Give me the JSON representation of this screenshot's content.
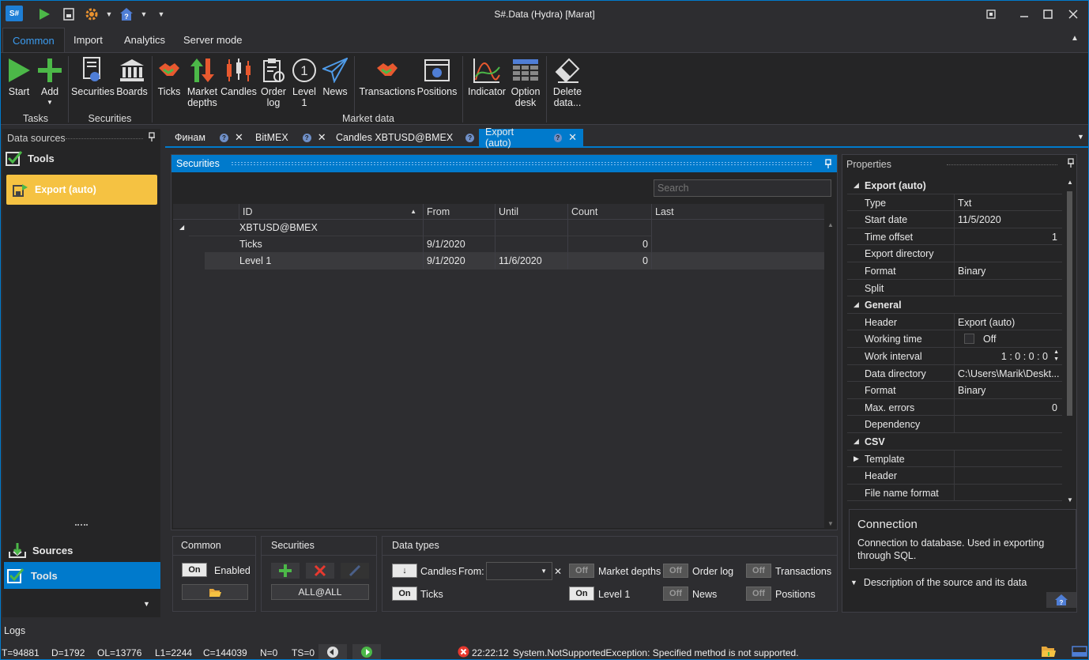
{
  "window": {
    "title": "S#.Data (Hydra) [Marat]",
    "logo": "S#"
  },
  "ribbon": {
    "tabs": [
      "Common",
      "Import",
      "Analytics",
      "Server mode"
    ],
    "buttons": {
      "start": "Start",
      "add": "Add",
      "securities": "Securities",
      "boards": "Boards",
      "ticks": "Ticks",
      "market_depths": "Market depths",
      "candles": "Candles",
      "order_log": "Order log",
      "level1": "Level 1",
      "news": "News",
      "transactions": "Transactions",
      "positions": "Positions",
      "indicator": "Indicator",
      "option_desk": "Option desk",
      "delete_data": "Delete data..."
    },
    "groups": {
      "tasks": "Tasks",
      "securities": "Securities",
      "market_data": "Market data"
    }
  },
  "left_panel": {
    "header": "Data sources",
    "tools_label": "Tools",
    "selected_item": "Export (auto)",
    "nav": {
      "sources": "Sources",
      "tools": "Tools"
    }
  },
  "doc_tabs": [
    "Финам",
    "BitMEX",
    "Candles XBTUSD@BMEX",
    "Export (auto)"
  ],
  "securities": {
    "header": "Securities",
    "search_placeholder": "Search",
    "columns": [
      "ID",
      "From",
      "Until",
      "Count",
      "Last"
    ],
    "group": "XBTUSD@BMEX",
    "rows": [
      {
        "id": "Ticks",
        "from": "9/1/2020",
        "until": "",
        "count": "0",
        "last": ""
      },
      {
        "id": "Level 1",
        "from": "9/1/2020",
        "until": "11/6/2020",
        "count": "0",
        "last": ""
      }
    ]
  },
  "common_box": {
    "title": "Common",
    "toggle": "On",
    "enabled_label": "Enabled"
  },
  "securities_box": {
    "title": "Securities",
    "all": "ALL@ALL"
  },
  "datatypes_box": {
    "title": "Data types",
    "candles": {
      "toggle": "↓",
      "label": "Candles",
      "from_label": "From:"
    },
    "ticks": {
      "toggle": "On",
      "label": "Ticks"
    },
    "market_depths": {
      "toggle": "Off",
      "label": "Market depths"
    },
    "level1": {
      "toggle": "On",
      "label": "Level 1"
    },
    "order_log": {
      "toggle": "Off",
      "label": "Order log"
    },
    "news": {
      "toggle": "Off",
      "label": "News"
    },
    "transactions": {
      "toggle": "Off",
      "label": "Transactions"
    },
    "positions": {
      "toggle": "Off",
      "label": "Positions"
    }
  },
  "properties": {
    "header": "Properties",
    "rows": [
      {
        "cat": true,
        "k": "Export (auto)",
        "v": ""
      },
      {
        "k": "Type",
        "v": "Txt"
      },
      {
        "k": "Start date",
        "v": "11/5/2020"
      },
      {
        "k": "Time offset",
        "vr": "1"
      },
      {
        "k": "Export directory",
        "v": ""
      },
      {
        "k": "Format",
        "v": "Binary"
      },
      {
        "k": "Split",
        "v": ""
      },
      {
        "cat": true,
        "k": "General",
        "v": ""
      },
      {
        "k": "Header",
        "v": "Export (auto)"
      },
      {
        "k": "Working time",
        "check": "Off"
      },
      {
        "k": "Work interval",
        "vr": "1 : 0 : 0 : 0"
      },
      {
        "k": "Data directory",
        "v": "C:\\Users\\Marik\\Deskt..."
      },
      {
        "k": "Format",
        "v": "Binary"
      },
      {
        "k": "Max. errors",
        "vr": "0"
      },
      {
        "k": "Dependency",
        "v": ""
      },
      {
        "cat": true,
        "k": "CSV",
        "v": ""
      },
      {
        "k": "Template",
        "v": "",
        "collapsed": true
      },
      {
        "k": "Header",
        "v": ""
      },
      {
        "k": "File name format",
        "v": ""
      }
    ],
    "desc_title": "Connection",
    "desc_text": "Connection to database. Used in exporting through SQL.",
    "footer": "Description of the source and its data"
  },
  "logs_label": "Logs",
  "status": {
    "t": "T=94881",
    "d": "D=1792",
    "ol": "OL=13776",
    "l1": "L1=2244",
    "c": "C=144039",
    "n": "N=0",
    "ts": "TS=0",
    "time": "22:22:12",
    "message": "System.NotSupportedException: Specified method is not supported."
  },
  "colors": {
    "accent": "#007acc",
    "highlight": "#f5c242",
    "bg": "#2d2d30"
  }
}
